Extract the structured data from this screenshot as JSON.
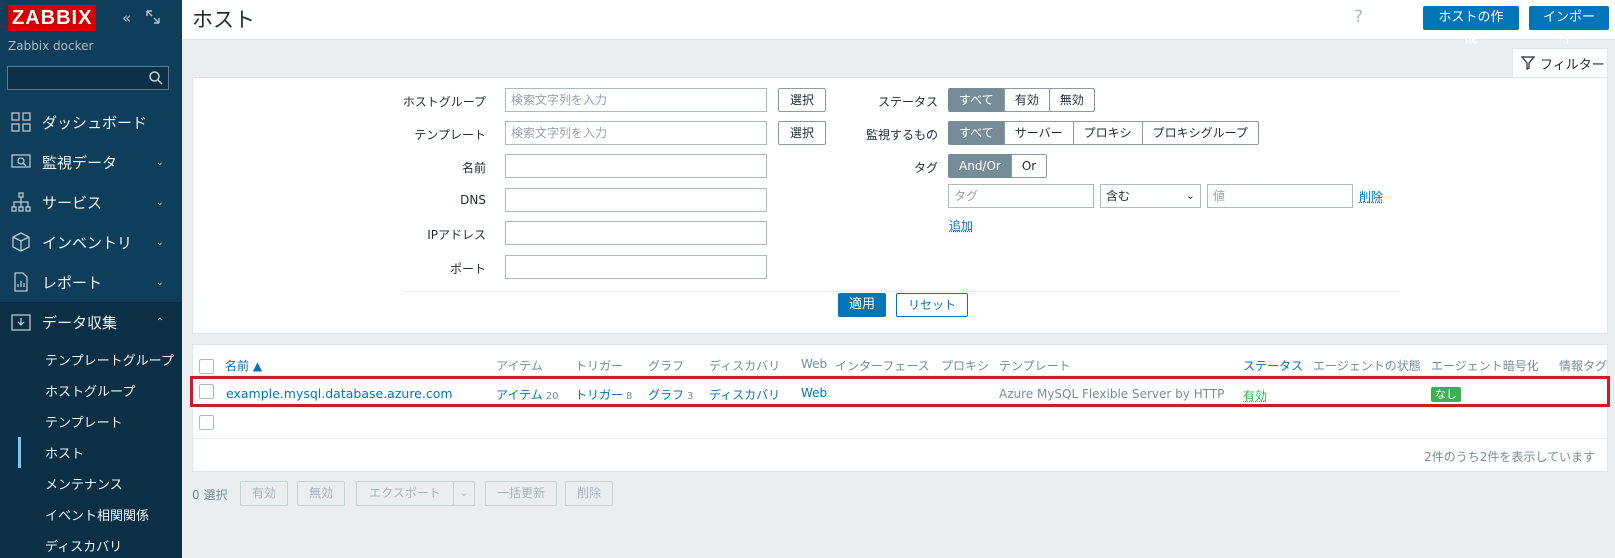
{
  "sidebar": {
    "logo": "ZABBIX",
    "server_name": "Zabbix docker",
    "search_placeholder": "",
    "menu": [
      {
        "label": "ダッシュボード",
        "icon": "dashboard-icon",
        "arrow": ""
      },
      {
        "label": "監視データ",
        "icon": "monitoring-icon",
        "arrow": "⌄"
      },
      {
        "label": "サービス",
        "icon": "services-icon",
        "arrow": "⌄"
      },
      {
        "label": "インベントリ",
        "icon": "inventory-icon",
        "arrow": "⌄"
      },
      {
        "label": "レポート",
        "icon": "reports-icon",
        "arrow": "⌄"
      },
      {
        "label": "データ収集",
        "icon": "data-collection-icon",
        "arrow": "⌃"
      }
    ],
    "submenu": [
      "テンプレートグループ",
      "ホストグループ",
      "テンプレート",
      "ホスト",
      "メンテナンス",
      "イベント相関関係",
      "ディスカバリ"
    ],
    "selected_submenu": "ホスト"
  },
  "header": {
    "title": "ホスト",
    "help": "?",
    "create_host": "ホストの作成",
    "import": "インポート"
  },
  "filter": {
    "tab_label": "フィルター",
    "host_group_label": "ホストグループ",
    "host_group_placeholder": "検索文字列を入力",
    "template_label": "テンプレート",
    "template_placeholder": "検索文字列を入力",
    "select": "選択",
    "name_label": "名前",
    "dns_label": "DNS",
    "ip_label": "IPアドレス",
    "port_label": "ポート",
    "status_label": "ステータス",
    "status_options": [
      "すべて",
      "有効",
      "無効"
    ],
    "monitored_by_label": "監視するもの",
    "monitored_by_options": [
      "すべて",
      "サーバー",
      "プロキシ",
      "プロキシグループ"
    ],
    "tags_label": "タグ",
    "tags_mode": [
      "And/Or",
      "Or"
    ],
    "tag_placeholder": "タグ",
    "tag_operator": "含む",
    "tag_value_placeholder": "値",
    "remove": "削除",
    "add": "追加",
    "apply": "適用",
    "reset": "リセット"
  },
  "table": {
    "columns": [
      "名前 ▲",
      "アイテム",
      "トリガー",
      "グラフ",
      "ディスカバリ",
      "Web",
      "インターフェース",
      "プロキシ",
      "テンプレート",
      "ステータス",
      "エージェントの状態",
      "エージェント暗号化",
      "情報",
      "タグ"
    ],
    "rows": [
      {
        "name": "example.mysql.database.azure.com",
        "items": "アイテム",
        "items_count": "20",
        "triggers": "トリガー",
        "triggers_count": "8",
        "graphs": "グラフ",
        "graphs_count": "3",
        "discovery": "ディスカバリ",
        "web": "Web",
        "template": "Azure MySQL Flexible Server by HTTP",
        "status": "有効",
        "encryption": "なし"
      }
    ],
    "summary": "2件のうち2件を表示しています"
  },
  "actions": {
    "selected": "0 選択",
    "enable": "有効",
    "disable": "無効",
    "export": "エクスポート",
    "mass_update": "一括更新",
    "delete": "削除"
  },
  "colors": {
    "sidebar_bg": "#0e3e59",
    "accent": "#0275b8",
    "highlight": "#c81e28",
    "status_ok": "#3db051"
  }
}
